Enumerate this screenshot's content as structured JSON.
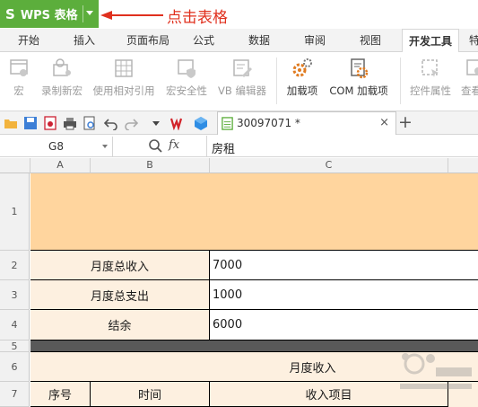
{
  "app": {
    "wps_button_label": "WPS 表格",
    "annotation": "点击表格",
    "colors": {
      "wps_green": "#5cae3c",
      "annotation_red": "#e0301e",
      "banner": "#ffd59e",
      "label_fill": "#fdf0e0",
      "dark_band": "#595959"
    }
  },
  "menu": {
    "tabs": [
      "开始",
      "插入",
      "页面布局",
      "公式",
      "数据",
      "审阅",
      "视图",
      "开发工具",
      "特"
    ],
    "active": "开发工具"
  },
  "ribbon": {
    "buttons": [
      {
        "label": "宏",
        "icon": "macro-icon"
      },
      {
        "label": "录制新宏",
        "icon": "record-macro-icon"
      },
      {
        "label": "使用相对引用",
        "icon": "relative-reference-icon"
      },
      {
        "label": "宏安全性",
        "icon": "macro-security-icon"
      },
      {
        "label": "VB 编辑器",
        "icon": "vb-editor-icon"
      },
      {
        "label": "加载项",
        "icon": "addins-icon"
      },
      {
        "label": "COM 加载项",
        "icon": "com-addins-icon"
      },
      {
        "label": "控件属性",
        "icon": "control-properties-icon"
      },
      {
        "label": "查看",
        "icon": "view-code-icon"
      }
    ]
  },
  "doc": {
    "tab_title": "30097071 *",
    "close_glyph": "×",
    "new_tab_glyph": "+"
  },
  "formula_bar": {
    "name_box": "G8",
    "fx_label": "fx",
    "value": "房租"
  },
  "grid": {
    "columns": [
      "A",
      "B",
      "C"
    ],
    "rows": [
      "1",
      "2",
      "3",
      "4",
      "5",
      "6",
      "7"
    ],
    "labels": {
      "total_income": "月度总收入",
      "total_expense": "月度总支出",
      "balance": "结余",
      "monthly_income": "月度收入",
      "seq_no": "序号",
      "time": "时间",
      "income_item": "收入项目"
    },
    "values": {
      "total_income": "7000",
      "total_expense": "1000",
      "balance": "6000"
    }
  }
}
